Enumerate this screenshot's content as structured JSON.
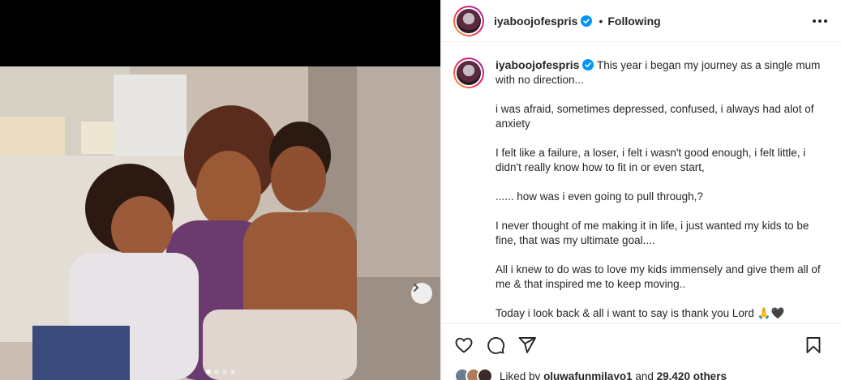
{
  "post": {
    "username": "iyaboojofespris",
    "follow_status": "Following",
    "separator": "•",
    "caption": [
      "This year i began my journey as a single mum with no direction...",
      "i was afraid, sometimes depressed, confused, i always had alot of anxiety",
      "I felt like a failure, a loser, i felt i wasn't good enough, i felt little, i didn't really know how to fit in or even start,",
      "...... how was i even going to pull through,?",
      "I never thought of me making it in life, i just wanted my kids to be fine, that was my ultimate goal....",
      "All i knew to do was to love my kids immensely and give them all of me & that inspired me to keep moving..",
      "Today i look back & all i want to say is thank you Lord 🙏🖤"
    ]
  },
  "likes": {
    "prefix": "Liked by",
    "user": "oluwafunmilayo1",
    "joiner": "and",
    "count": "29,420 others"
  },
  "carousel": {
    "slides": 4,
    "active_index": 0
  },
  "icons": [
    "verified-badge-icon",
    "more-options-icon",
    "heart-icon",
    "comment-icon",
    "share-icon",
    "bookmark-icon",
    "chevron-right-icon"
  ],
  "colors": {
    "verified": "#0095f6",
    "text": "#262626",
    "divider": "#efefef"
  }
}
